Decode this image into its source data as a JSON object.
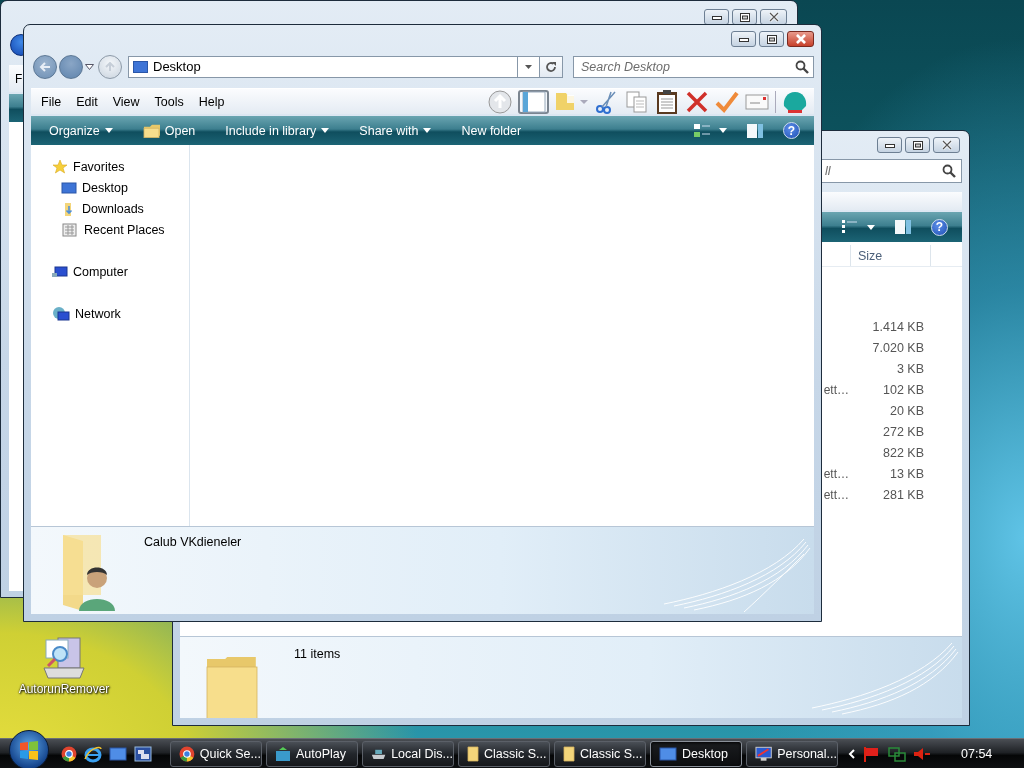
{
  "left_window": {
    "menu_fragment": "F"
  },
  "right_window": {
    "search_placeholder": "ll",
    "columns": [
      {
        "label": "Size"
      }
    ],
    "rows": [
      {
        "size": "1.414 KB"
      },
      {
        "size": "7.020 KB"
      },
      {
        "size": "3 KB"
      },
      {
        "name": "ett…",
        "size": "102 KB"
      },
      {
        "size": "20 KB"
      },
      {
        "size": "272 KB"
      },
      {
        "size": "822 KB"
      },
      {
        "name": "ett…",
        "size": "13 KB"
      },
      {
        "name": "ett…",
        "size": "281 KB"
      }
    ],
    "details": "11 items",
    "help_label": "?"
  },
  "main_window": {
    "address": "Desktop",
    "search_placeholder": "Search Desktop",
    "menu": [
      "File",
      "Edit",
      "View",
      "Tools",
      "Help"
    ],
    "commands": [
      {
        "label": "Organize",
        "dropdown": true,
        "icon": false
      },
      {
        "label": "Open",
        "dropdown": false,
        "icon": true
      },
      {
        "label": "Include in library",
        "dropdown": true,
        "icon": false
      },
      {
        "label": "Share with",
        "dropdown": true,
        "icon": false
      },
      {
        "label": "New folder",
        "dropdown": false,
        "icon": false
      }
    ],
    "navigation": [
      {
        "label": "Favorites",
        "kind": "favorites",
        "children": [
          {
            "label": "Desktop",
            "kind": "desktop"
          },
          {
            "label": "Downloads",
            "kind": "downloads"
          },
          {
            "label": "Recent Places",
            "kind": "recent"
          }
        ]
      },
      {
        "label": "Computer",
        "kind": "computer"
      },
      {
        "label": "Network",
        "kind": "network"
      }
    ],
    "details": "Calub VKdieneler",
    "help_label": "?"
  },
  "desktop_icons": [
    {
      "label": "AutorunRemover"
    }
  ],
  "taskbar": {
    "buttons": [
      {
        "label": "Quick Se...",
        "kind": "chrome",
        "selected": false
      },
      {
        "label": "AutoPlay",
        "kind": "autoplay",
        "selected": false
      },
      {
        "label": "Local Dis...",
        "kind": "drive",
        "selected": false
      },
      {
        "label": "Classic S...",
        "kind": "folder",
        "selected": false
      },
      {
        "label": "Classic S...",
        "kind": "folder",
        "selected": false
      },
      {
        "label": "Desktop",
        "kind": "desktop",
        "selected": true
      },
      {
        "label": "Personal...",
        "kind": "display",
        "selected": false
      }
    ],
    "clock": "07:54"
  }
}
